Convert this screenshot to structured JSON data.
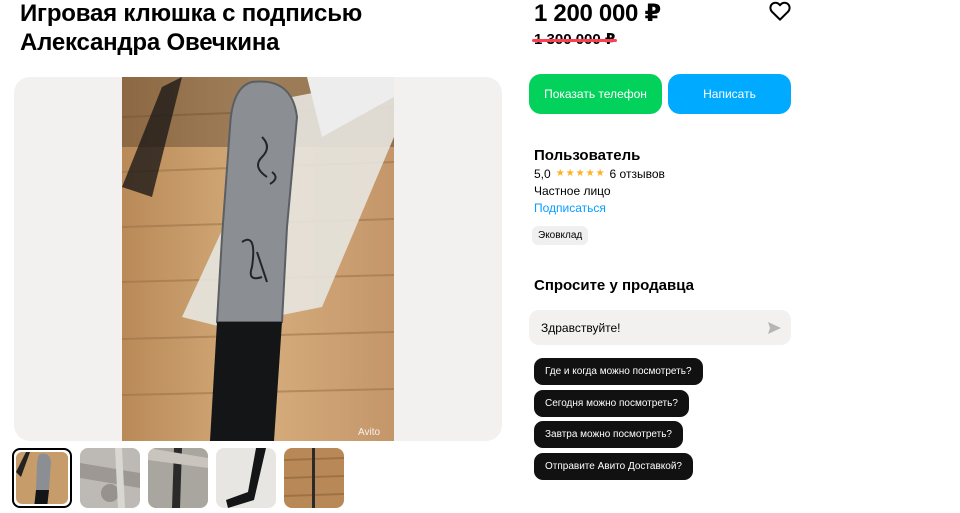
{
  "listing": {
    "title_line1": "Игровая клюшка с подписью",
    "title_line2": "Александра Овечкина",
    "price": "1 200 000 ₽",
    "old_price": "1 300 000 ₽",
    "watermark": "Avito"
  },
  "gallery": {
    "thumbnail_count": 5,
    "active_index": 0
  },
  "actions": {
    "phone_label": "Показать телефон",
    "write_label": "Написать",
    "phone_color": "#02d15c",
    "write_color": "#00aaff"
  },
  "seller": {
    "name": "Пользователь",
    "rating": "5,0",
    "stars": 5,
    "reviews": "6 отзывов",
    "type": "Частное лицо",
    "subscribe_label": "Подписаться",
    "badge": "Эковклад"
  },
  "ask": {
    "title": "Спросите у продавца",
    "input_value": "Здравствуйте!",
    "quick_questions": [
      "Где и когда можно посмотреть?",
      "Сегодня можно посмотреть?",
      "Завтра можно посмотреть?",
      "Отправите Авито Доставкой?"
    ]
  },
  "icons": {
    "favorite": "heart-icon",
    "send": "send-arrow-icon"
  }
}
